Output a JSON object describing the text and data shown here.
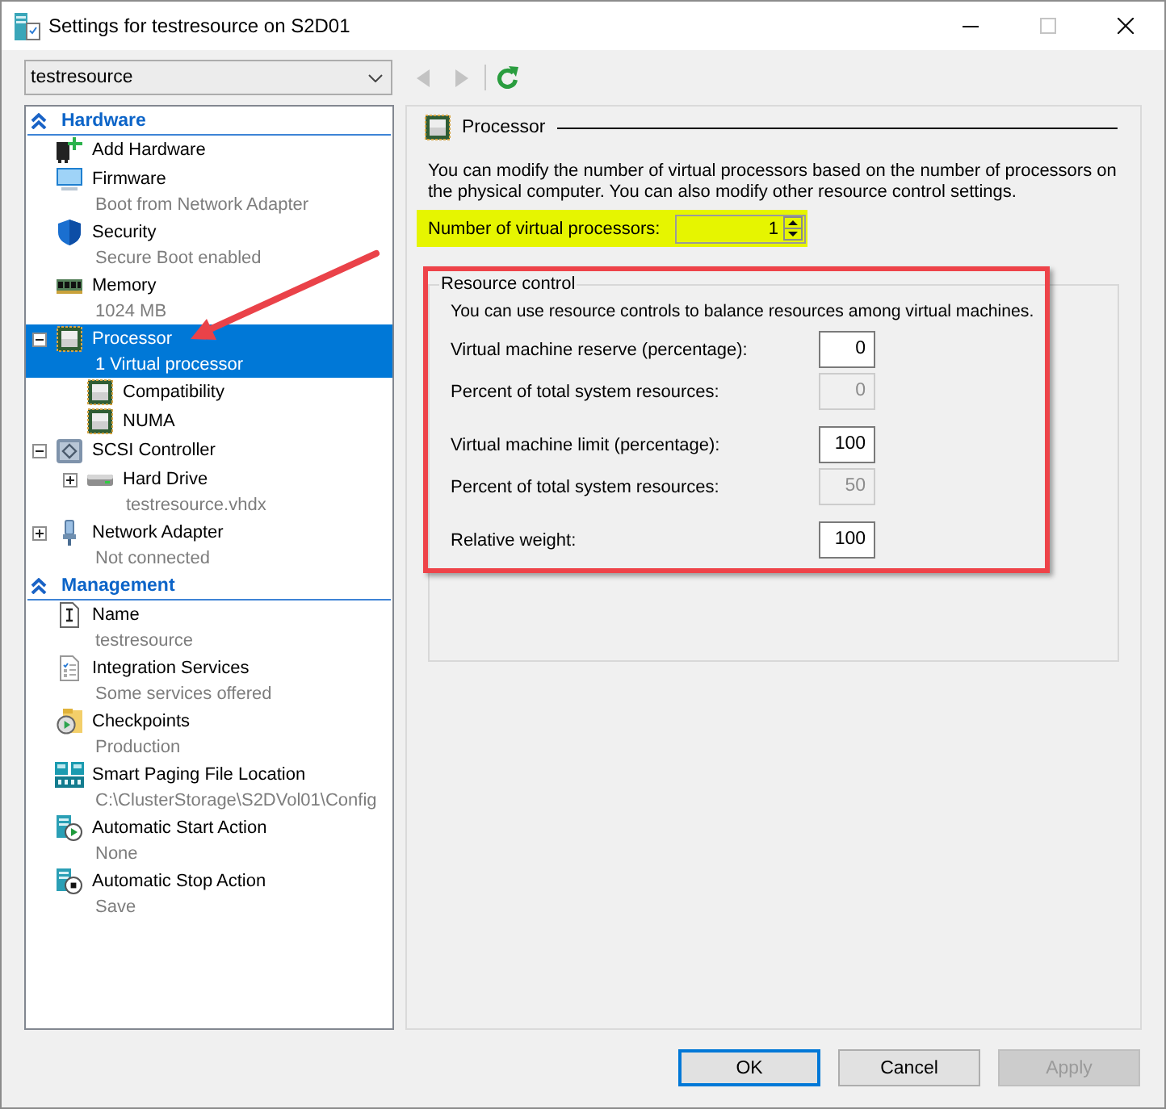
{
  "window": {
    "title": "Settings for testresource on S2D01",
    "controls": [
      {
        "kind": "minimize",
        "disabled": false
      },
      {
        "kind": "maximize",
        "disabled": true
      },
      {
        "kind": "close",
        "disabled": false
      }
    ]
  },
  "vm_selector": {
    "value": "testresource"
  },
  "navigation": [
    {
      "kind": "back",
      "disabled": true
    },
    {
      "kind": "forward",
      "disabled": true
    },
    {
      "kind": "refresh",
      "disabled": false
    }
  ],
  "sidebar": {
    "sections": [
      {
        "title": "Hardware",
        "expanded": true,
        "items": [
          {
            "kind": "add",
            "label": "Add Hardware",
            "selected": false
          },
          {
            "kind": "firmware",
            "label": "Firmware",
            "detail": "Boot from Network Adapter",
            "selected": false
          },
          {
            "kind": "security",
            "label": "Security",
            "detail": "Secure Boot enabled",
            "selected": false
          },
          {
            "kind": "memory",
            "label": "Memory",
            "detail": "1024 MB",
            "selected": false
          },
          {
            "kind": "chip",
            "label": "Processor",
            "detail": "1 Virtual processor",
            "selected": true,
            "expanded": true,
            "children": [
              {
                "kind": "chip",
                "label": "Compatibility",
                "selected": false
              },
              {
                "kind": "chip",
                "label": "NUMA",
                "selected": false
              }
            ]
          },
          {
            "kind": "scsi",
            "label": "SCSI Controller",
            "selected": false,
            "expanded": true,
            "children": [
              {
                "kind": "disk",
                "label": "Hard Drive",
                "detail": "testresource.vhdx",
                "selected": false,
                "expanded": false
              }
            ]
          },
          {
            "kind": "network",
            "label": "Network Adapter",
            "detail": "Not connected",
            "selected": false,
            "expanded": false
          }
        ]
      },
      {
        "title": "Management",
        "expanded": true,
        "items": [
          {
            "kind": "name",
            "label": "Name",
            "detail": "testresource",
            "selected": false
          },
          {
            "kind": "integration",
            "label": "Integration Services",
            "detail": "Some services offered",
            "selected": false
          },
          {
            "kind": "checkpoint",
            "label": "Checkpoints",
            "detail": "Production",
            "selected": false
          },
          {
            "kind": "paging",
            "label": "Smart Paging File Location",
            "detail": "C:\\ClusterStorage\\S2DVol01\\Config",
            "selected": false
          },
          {
            "kind": "start",
            "label": "Automatic Start Action",
            "detail": "None",
            "selected": false
          },
          {
            "kind": "stop",
            "label": "Automatic Stop Action",
            "detail": "Save",
            "selected": false
          }
        ]
      }
    ]
  },
  "panel": {
    "title": "Processor",
    "description": "You can modify the number of virtual processors based on the number of processors on the physical computer. You can also modify other resource control settings.",
    "processors": {
      "label": "Number of virtual processors:",
      "value": "1",
      "highlighted": true
    },
    "resource_control": {
      "title": "Resource control",
      "description": "You can use resource controls to balance resources among virtual machines.",
      "field_groups": [
        [
          {
            "label": "Virtual machine reserve (percentage):",
            "value": "0",
            "disabled": false
          },
          {
            "label": "Percent of total system resources:",
            "value": "0",
            "disabled": true
          }
        ],
        [
          {
            "label": "Virtual machine limit (percentage):",
            "value": "100",
            "disabled": false
          },
          {
            "label": "Percent of total system resources:",
            "value": "50",
            "disabled": true
          }
        ],
        [
          {
            "label": "Relative weight:",
            "value": "100",
            "disabled": false
          }
        ]
      ]
    }
  },
  "buttons": [
    {
      "label": "OK",
      "default": true,
      "disabled": false
    },
    {
      "label": "Cancel",
      "default": false,
      "disabled": false
    },
    {
      "label": "Apply",
      "default": false,
      "disabled": true
    }
  ],
  "annotations": {
    "arrow": true,
    "frame": true
  }
}
